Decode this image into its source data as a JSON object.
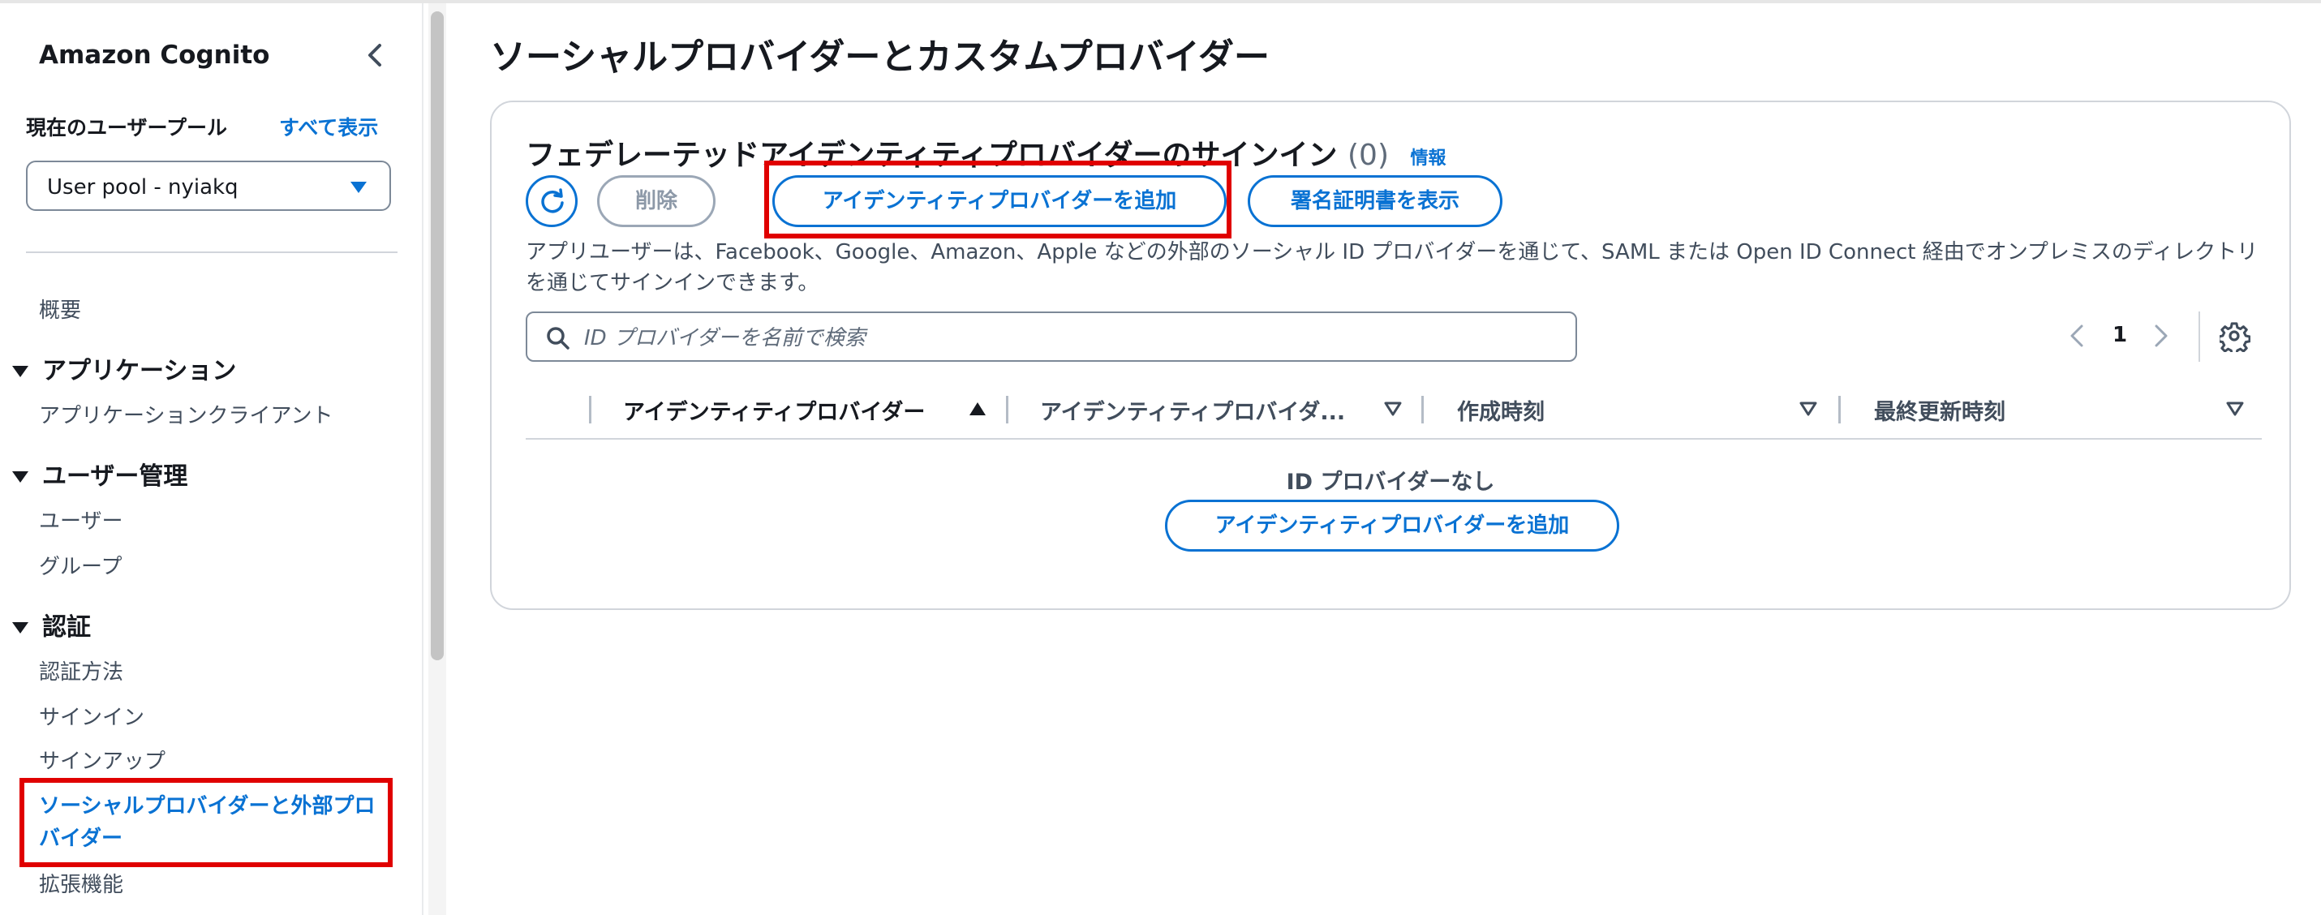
{
  "sidebar": {
    "title": "Amazon Cognito",
    "current_pool_label": "現在のユーザープール",
    "show_all": "すべて表示",
    "pool_select_value": "User pool - nyiakq",
    "overview": "概要",
    "sections": [
      {
        "label": "アプリケーション",
        "items": [
          "アプリケーションクライアント"
        ]
      },
      {
        "label": "ユーザー管理",
        "items": [
          "ユーザー",
          "グループ"
        ]
      },
      {
        "label": "認証",
        "items": [
          "認証方法",
          "サインイン",
          "サインアップ",
          "ソーシャルプロバイダーと外部プロバイダー",
          "拡張機能"
        ]
      }
    ]
  },
  "page": {
    "title": "ソーシャルプロバイダーとカスタムプロバイダー"
  },
  "panel": {
    "heading": "フェデレーテッドアイデンティティプロバイダーのサインイン",
    "count": "(0)",
    "info": "情報",
    "delete_label": "削除",
    "add_label": "アイデンティティプロバイダーを追加",
    "cert_label": "署名証明書を表示",
    "description": "アプリユーザーは、Facebook、Google、Amazon、Apple などの外部のソーシャル ID プロバイダーを通じて、SAML または Open ID Connect 経由でオンプレミスのディレクトリを通じてサインインできます。",
    "search_placeholder": "ID プロバイダーを名前で検索",
    "page_number": "1",
    "columns": [
      "アイデンティティプロバイダー",
      "アイデンティティプロバイダ...",
      "作成時刻",
      "最終更新時刻"
    ],
    "empty_title": "ID プロバイダーなし",
    "empty_add_label": "アイデンティティプロバイダーを追加"
  },
  "colors": {
    "accent": "#0972d3",
    "highlight": "#e00000"
  }
}
